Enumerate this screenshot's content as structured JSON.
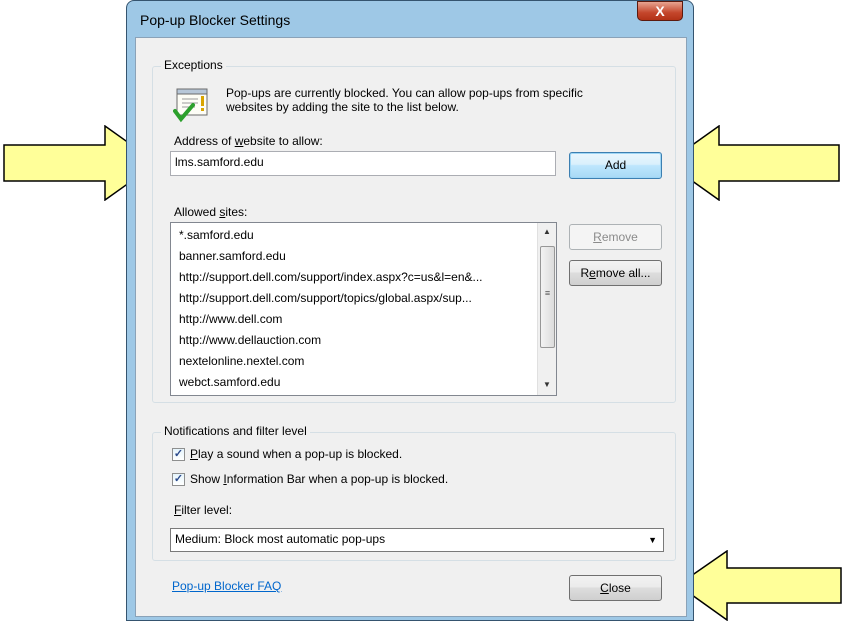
{
  "window": {
    "title": "Pop-up Blocker Settings",
    "close_glyph": "X"
  },
  "exceptions": {
    "group_label": "Exceptions",
    "info_icon": "popup-allow-icon",
    "description_line1": "Pop-ups are currently blocked.  You can allow pop-ups from specific",
    "description_line2": "websites by adding the site to the list below.",
    "address_label_pre": "Address of ",
    "address_label_key": "w",
    "address_label_post": "ebsite to allow:",
    "address_value": "lms.samford.edu",
    "add_button": "Add",
    "allowed_label_pre": "Allowed ",
    "allowed_label_key": "s",
    "allowed_label_post": "ites:",
    "allowed_sites": [
      "*.samford.edu",
      "banner.samford.edu",
      "http://support.dell.com/support/index.aspx?c=us&l=en&...",
      "http://support.dell.com/support/topics/global.aspx/sup...",
      "http://www.dell.com",
      "http://www.dellauction.com",
      "nextelonline.nextel.com",
      "webct.samford.edu"
    ],
    "remove_button_key": "R",
    "remove_button_rest": "emove",
    "remove_all_key": "e",
    "remove_all_pre": "R",
    "remove_all_post": "move all..."
  },
  "notifications": {
    "group_label": "Notifications and filter level",
    "play_sound_key": "P",
    "play_sound_rest": "lay a sound when a pop-up is blocked.",
    "play_sound_checked": true,
    "show_info_pre": "Show ",
    "show_info_key": "I",
    "show_info_post": "nformation Bar when a pop-up is blocked.",
    "show_info_checked": true,
    "filter_label_key": "F",
    "filter_label_rest": "ilter level:",
    "filter_value": "Medium: Block most automatic pop-ups",
    "check_glyph": "✓"
  },
  "footer": {
    "faq_link": "Pop-up Blocker FAQ",
    "close_key": "C",
    "close_rest": "lose"
  },
  "colors": {
    "arrow_fill": "#ffff99",
    "arrow_stroke": "#000000",
    "link": "#0066cc"
  }
}
